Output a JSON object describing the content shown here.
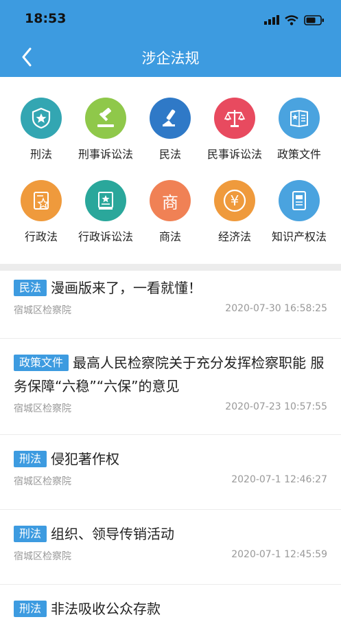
{
  "status_bar": {
    "time": "18:53"
  },
  "header": {
    "title": "涉企法规"
  },
  "categories": [
    {
      "label": "刑法",
      "color": "#33a6b2",
      "icon": "shield-star-icon"
    },
    {
      "label": "刑事诉讼法",
      "color": "#8fc84a",
      "icon": "gavel-icon"
    },
    {
      "label": "民法",
      "color": "#2f79c7",
      "icon": "stamp-icon"
    },
    {
      "label": "民事诉讼法",
      "color": "#e84a5f",
      "icon": "scales-icon"
    },
    {
      "label": "政策文件",
      "color": "#4aa3df",
      "icon": "document-star-icon"
    },
    {
      "label": "行政法",
      "color": "#ef9a3c",
      "icon": "certificate-star-icon"
    },
    {
      "label": "行政诉讼法",
      "color": "#2aa79b",
      "icon": "book-star-icon"
    },
    {
      "label": "商法",
      "color": "#f08155",
      "icon_text": "商"
    },
    {
      "label": "经济法",
      "color": "#ef9a3c",
      "icon_text": "¥"
    },
    {
      "label": "知识产权法",
      "color": "#4aa3df",
      "icon": "document-lines-icon"
    }
  ],
  "articles": [
    {
      "tag": "民法",
      "title": "漫画版来了，一看就懂！",
      "source": "宿城区检察院",
      "date": "2020-07-30 16:58:25"
    },
    {
      "tag": "政策文件",
      "title": "最高人民检察院关于充分发挥检察职能 服务保障“六稳”“六保”的意见",
      "source": "宿城区检察院",
      "date": "2020-07-23 10:57:55"
    },
    {
      "tag": "刑法",
      "title": "侵犯著作权",
      "source": "宿城区检察院",
      "date": "2020-07-1 12:46:27"
    },
    {
      "tag": "刑法",
      "title": "组织、领导传销活动",
      "source": "宿城区检察院",
      "date": "2020-07-1 12:45:59"
    },
    {
      "tag": "刑法",
      "title": "非法吸收公众存款",
      "source": "",
      "date": ""
    }
  ]
}
